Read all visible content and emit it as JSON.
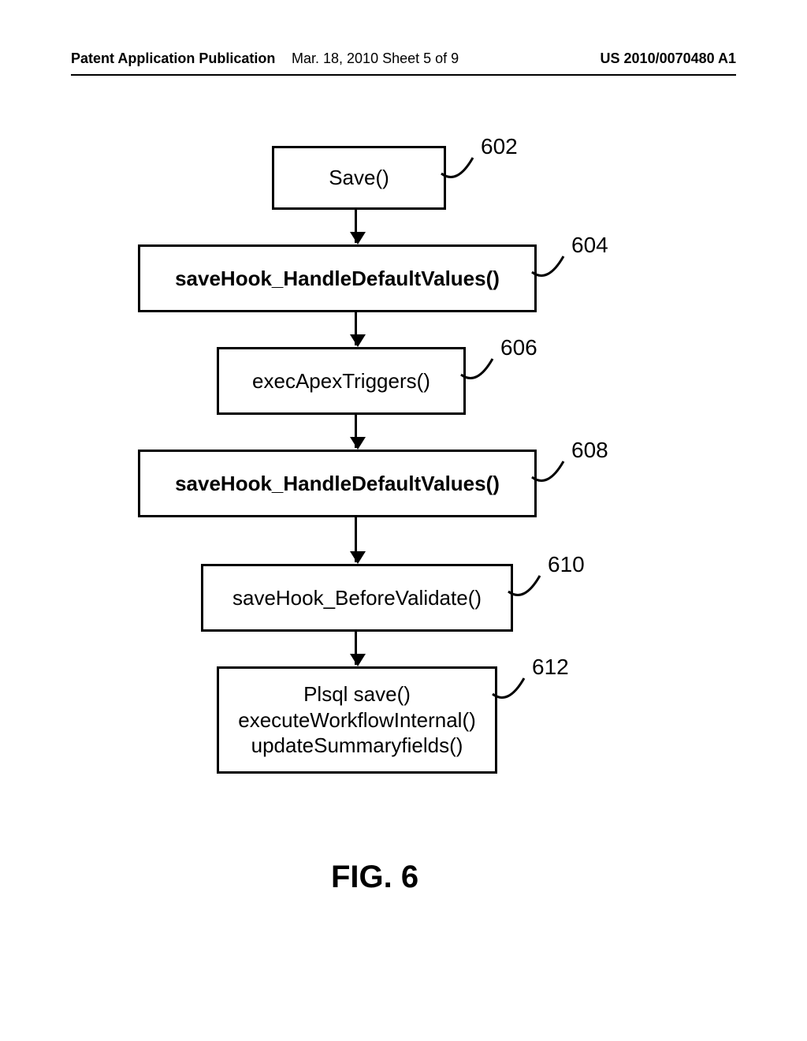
{
  "header": {
    "publication_label": "Patent Application Publication",
    "date_sheet": "Mar. 18, 2010   Sheet 5 of 9",
    "pub_number": "US 2010/0070480 A1"
  },
  "boxes": {
    "b602": {
      "text": "Save()",
      "ref": "602",
      "bold": false
    },
    "b604": {
      "text": "saveHook_HandleDefaultValues()",
      "ref": "604",
      "bold": true
    },
    "b606": {
      "text": "execApexTriggers()",
      "ref": "606",
      "bold": false
    },
    "b608": {
      "text": "saveHook_HandleDefaultValues()",
      "ref": "608",
      "bold": true
    },
    "b610": {
      "text": "saveHook_BeforeValidate()",
      "ref": "610",
      "bold": false
    },
    "b612": {
      "text": "Plsql save()\nexecuteWorkflowInternal()\nupdateSummaryfields()",
      "ref": "612",
      "bold": false
    }
  },
  "figure_caption": "FIG. 6"
}
